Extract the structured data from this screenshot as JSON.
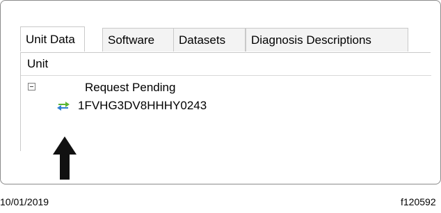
{
  "tabs": [
    {
      "label": "Unit Data",
      "active": true
    },
    {
      "label": "Software",
      "active": false
    },
    {
      "label": "Datasets",
      "active": false
    },
    {
      "label": "Diagnosis Descriptions",
      "active": false
    }
  ],
  "table": {
    "column_header": "Unit",
    "group_row": {
      "label": "Request Pending",
      "expanded": true
    },
    "unit_row": {
      "label": "1FVHG3DV8HHHY0243",
      "icon": "sync-arrows-icon"
    }
  },
  "callout": {
    "icon": "up-arrow-icon"
  },
  "footer": {
    "date": "10/01/2019",
    "figure_id": "f120592"
  },
  "colors": {
    "frame_border": "#8a8a8a",
    "tab_inactive_bg": "#f3f3f3",
    "icon_green": "#5cb531",
    "icon_blue": "#2f7fd1"
  }
}
